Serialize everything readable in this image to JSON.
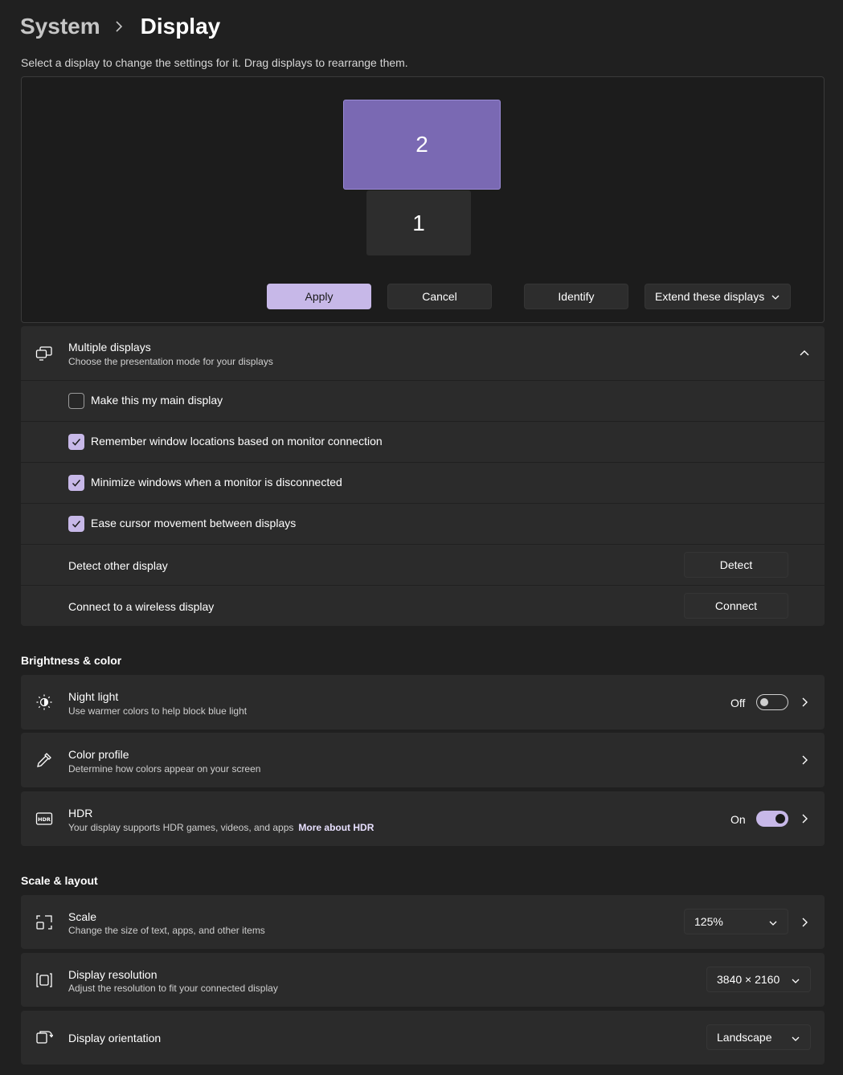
{
  "header": {
    "parent": "System",
    "current": "Display"
  },
  "arrangement": {
    "instruction": "Select a display to change the settings for it. Drag displays to rearrange them.",
    "monitors": [
      {
        "label": "2",
        "selected": true
      },
      {
        "label": "1",
        "selected": false
      }
    ],
    "buttons": {
      "apply": "Apply",
      "cancel": "Cancel",
      "identify": "Identify",
      "mode": "Extend these displays"
    }
  },
  "multiple_displays": {
    "title": "Multiple displays",
    "description": "Choose the presentation mode for your displays",
    "expanded": true,
    "options": [
      {
        "label": "Make this my main display",
        "checked": false
      },
      {
        "label": "Remember window locations based on monitor connection",
        "checked": true
      },
      {
        "label": "Minimize windows when a monitor is disconnected",
        "checked": true
      },
      {
        "label": "Ease cursor movement between displays",
        "checked": true
      }
    ],
    "detect": {
      "label": "Detect other display",
      "button": "Detect"
    },
    "wireless": {
      "label": "Connect to a wireless display",
      "button": "Connect"
    }
  },
  "brightness_color": {
    "heading": "Brightness & color",
    "night_light": {
      "title": "Night light",
      "description": "Use warmer colors to help block blue light",
      "state": "Off",
      "on": false
    },
    "color_profile": {
      "title": "Color profile",
      "description": "Determine how colors appear on your screen"
    },
    "hdr": {
      "title": "HDR",
      "description": "Your display supports HDR games, videos, and apps",
      "link": "More about HDR",
      "state": "On",
      "on": true
    }
  },
  "scale_layout": {
    "heading": "Scale & layout",
    "scale": {
      "title": "Scale",
      "description": "Change the size of text, apps, and other items",
      "value": "125%"
    },
    "resolution": {
      "title": "Display resolution",
      "description": "Adjust the resolution to fit your connected display",
      "value": "3840 × 2160"
    },
    "orientation": {
      "title": "Display orientation",
      "value": "Landscape"
    }
  },
  "colors": {
    "background": "#202020",
    "card": "#2b2b2b",
    "accent": "#c7b8e8",
    "selected_monitor": "#7a69b3"
  },
  "icons": {
    "breadcrumb_separator": "chevron-right-icon",
    "multiple_displays": "multiple-displays-icon",
    "night_light": "night-light-icon",
    "color_profile": "eyedropper-icon",
    "hdr": "hdr-icon",
    "scale": "scale-icon",
    "resolution": "resolution-icon",
    "orientation": "orientation-icon"
  }
}
